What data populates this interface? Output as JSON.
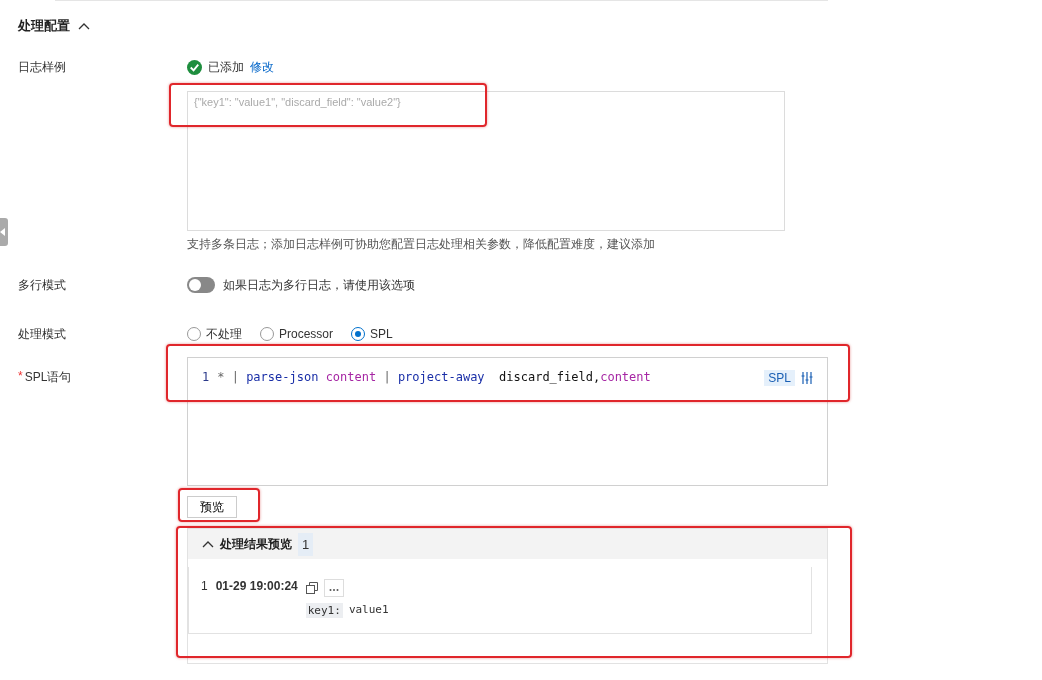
{
  "section": {
    "title": "处理配置",
    "expanded": true
  },
  "log_sample": {
    "label": "日志样例",
    "status": "已添加",
    "edit_link": "修改",
    "value": "{\"key1\": \"value1\", \"discard_field\": \"value2\"}",
    "highlighted": true,
    "help": "支持多条日志；添加日志样例可协助您配置日志处理相关参数，降低配置难度，建议添加"
  },
  "multiline": {
    "label": "多行模式",
    "on": false,
    "hint": "如果日志为多行日志，请使用该选项"
  },
  "mode": {
    "label": "处理模式",
    "options": [
      {
        "label": "不处理",
        "selected": false
      },
      {
        "label": "Processor",
        "selected": false
      },
      {
        "label": "SPL",
        "selected": true
      }
    ]
  },
  "spl": {
    "label": "SPL语句",
    "required_mark": "*",
    "highlighted": true,
    "line_number": "1",
    "badge": "SPL",
    "tokens": [
      {
        "kind": "op",
        "text": "* | "
      },
      {
        "kind": "fn",
        "text": "parse-json "
      },
      {
        "kind": "field",
        "text": "content"
      },
      {
        "kind": "op",
        "text": " | "
      },
      {
        "kind": "fn",
        "text": "project-away"
      },
      {
        "kind": "plain",
        "text": "  discard_field,"
      },
      {
        "kind": "field",
        "text": "content"
      }
    ]
  },
  "preview_button": {
    "label": "预览",
    "highlighted": true
  },
  "preview": {
    "title": "处理结果预览",
    "count": "1",
    "expanded": true,
    "highlighted": true,
    "rows": [
      {
        "index": "1",
        "time": "01-29 19:00:24",
        "fields": [
          {
            "key": "key1:",
            "value": "value1"
          }
        ]
      }
    ]
  }
}
